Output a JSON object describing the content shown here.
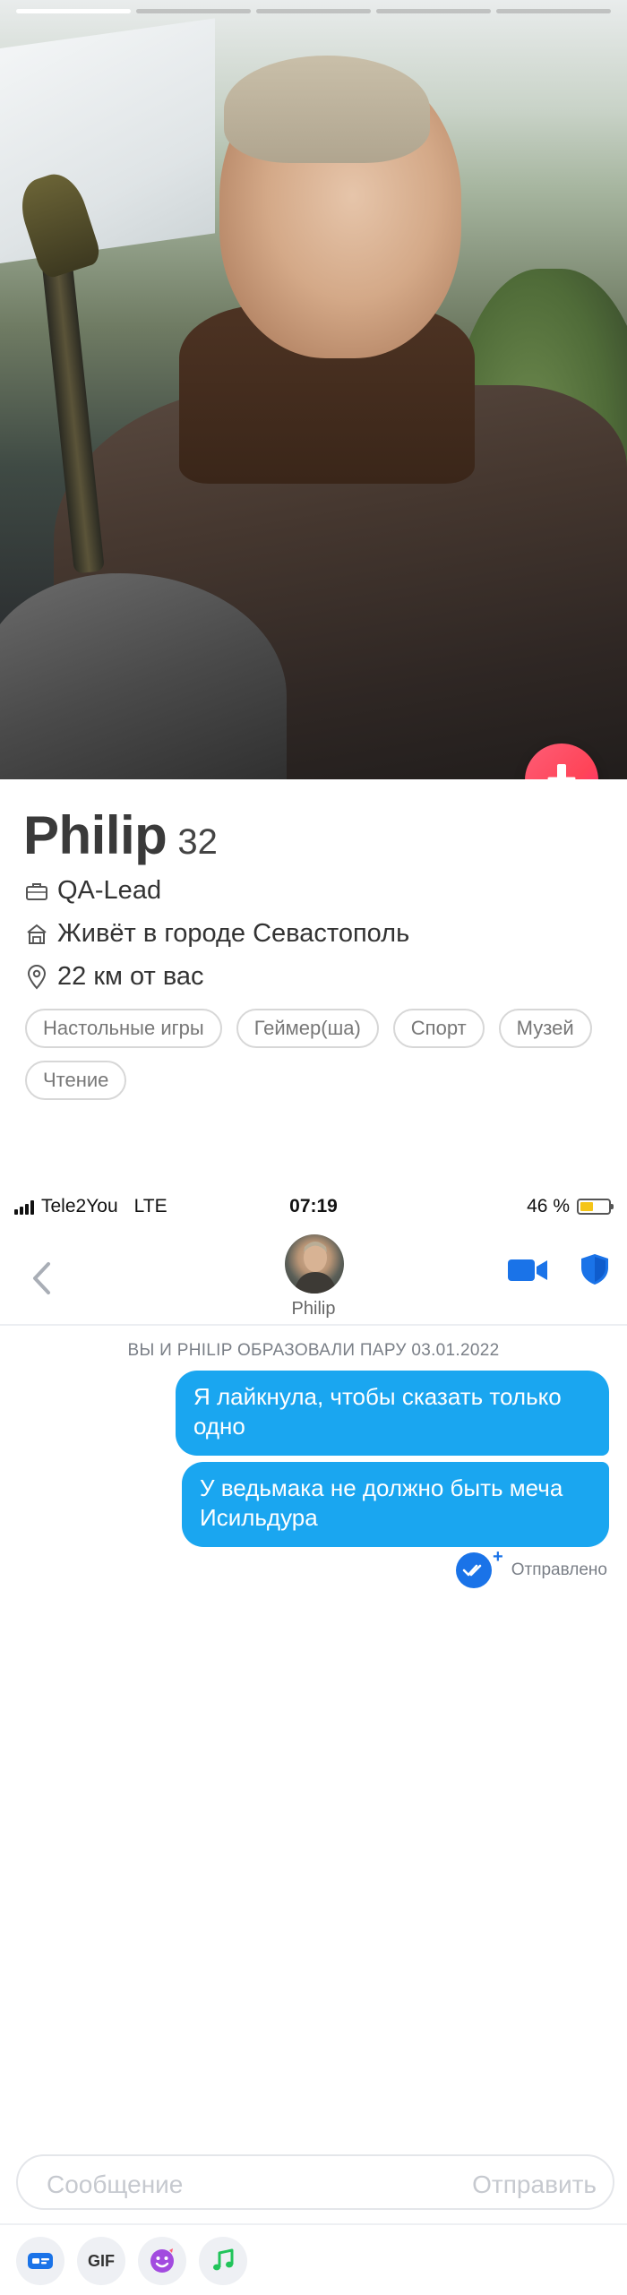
{
  "profile": {
    "name": "Philip",
    "age": "32",
    "job": "QA-Lead",
    "city": "Живёт в городе Севастополь",
    "distance": "22 км от вас",
    "photo_count": 5,
    "active_photo": 1,
    "interests": [
      "Настольные игры",
      "Геймер(ша)",
      "Спорт",
      "Музей",
      "Чтение"
    ],
    "icons": {
      "job": "briefcase-icon",
      "city": "house-icon",
      "distance": "location-pin-icon",
      "collapse": "arrow-down-icon"
    },
    "colors": {
      "collapse_button": "#ff4458"
    }
  },
  "statusbar": {
    "carrier": "Tele2You",
    "network": "LTE",
    "time": "07:19",
    "battery": "46 %",
    "battery_level": 0.46
  },
  "chat": {
    "header": {
      "name": "Philip",
      "icons": [
        "chevron-left-icon",
        "video-camera-icon",
        "shield-icon"
      ]
    },
    "match_note": "ВЫ И PHILIP ОБРАЗОВАЛИ ПАРУ 03.01.2022",
    "messages": [
      {
        "from": "me",
        "text": "Я лайкнула, чтобы сказать только одно"
      },
      {
        "from": "me",
        "text": "У ведьмака не должно быть меча Исильдура"
      }
    ],
    "status": "Отправлено",
    "composer": {
      "placeholder": "Сообщение",
      "send_label": "Отправить"
    },
    "tools": [
      "sticker-icon",
      "GIF",
      "emoji-icon",
      "music-icon"
    ],
    "colors": {
      "bubble": "#1aa6f0",
      "accent": "#1a73e8",
      "music": "#21c45a",
      "emoji": "#a24bdf"
    }
  }
}
